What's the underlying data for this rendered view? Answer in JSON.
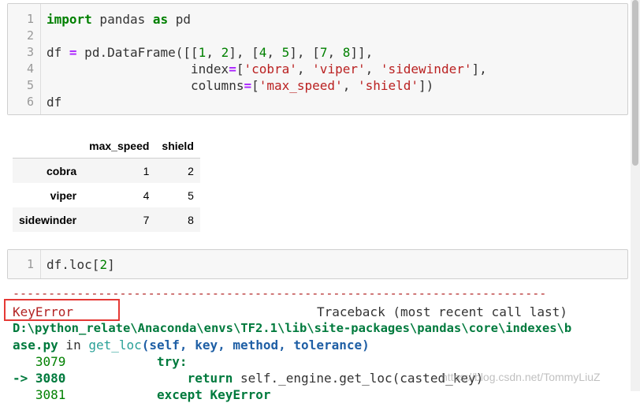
{
  "cell1": {
    "line_numbers": [
      "1",
      "2",
      "3",
      "4",
      "5",
      "6"
    ],
    "lines": {
      "l1_import": "import",
      "l1_mod": " pandas ",
      "l1_as": "as",
      "l1_alias": " pd",
      "l3_a": "df ",
      "l3_eq": "=",
      "l3_b": " pd.DataFrame([[",
      "l3_n1": "1",
      "l3_c1": ", ",
      "l3_n2": "2",
      "l3_c2": "], [",
      "l3_n3": "4",
      "l3_c3": ", ",
      "l3_n4": "5",
      "l3_c4": "], [",
      "l3_n5": "7",
      "l3_c5": ", ",
      "l3_n6": "8",
      "l3_c6": "]],",
      "l4_a": "                   index",
      "l4_eq": "=",
      "l4_b": "[",
      "l4_s1": "'cobra'",
      "l4_c1": ", ",
      "l4_s2": "'viper'",
      "l4_c2": ", ",
      "l4_s3": "'sidewinder'",
      "l4_c3": "],",
      "l5_a": "                   columns",
      "l5_eq": "=",
      "l5_b": "[",
      "l5_s1": "'max_speed'",
      "l5_c1": ", ",
      "l5_s2": "'shield'",
      "l5_c2": "])",
      "l6": "df"
    }
  },
  "dataframe": {
    "columns": [
      "max_speed",
      "shield"
    ],
    "rows": [
      {
        "index": "cobra",
        "max_speed": "1",
        "shield": "2"
      },
      {
        "index": "viper",
        "max_speed": "4",
        "shield": "5"
      },
      {
        "index": "sidewinder",
        "max_speed": "7",
        "shield": "8"
      }
    ]
  },
  "cell2": {
    "line_number": "1",
    "code_a": "df.loc[",
    "code_num": "2",
    "code_b": "]"
  },
  "traceback": {
    "dashes": "---------------------------------------------------------------------------",
    "error_name": "KeyError",
    "header": "Traceback (most recent call last)",
    "path_line1": "D:\\python_relate\\Anaconda\\envs\\TF2.1\\lib\\site-packages\\pandas\\core\\indexes\\b",
    "path_line2": "ase.py",
    "in_word": " in ",
    "func": "get_loc",
    "args": "(self, key, method, tolerance)",
    "l3079_num": "   3079",
    "l3079_code": "            try:",
    "l3080_arrow": "-> 3080",
    "l3080_return": "                return",
    "l3080_code": " self._engine.get_loc(casted_key)",
    "l3081_num": "   3081",
    "l3081_code": "            except KeyError"
  },
  "watermark": "https://blog.csdn.net/TommyLiuZ",
  "colors": {
    "keyword": "#008000",
    "string": "#ba2121",
    "error_red": "#b22222",
    "highlight_box": "#e53935",
    "path_green": "#007a3d",
    "func_blue": "#1f5fa5"
  }
}
